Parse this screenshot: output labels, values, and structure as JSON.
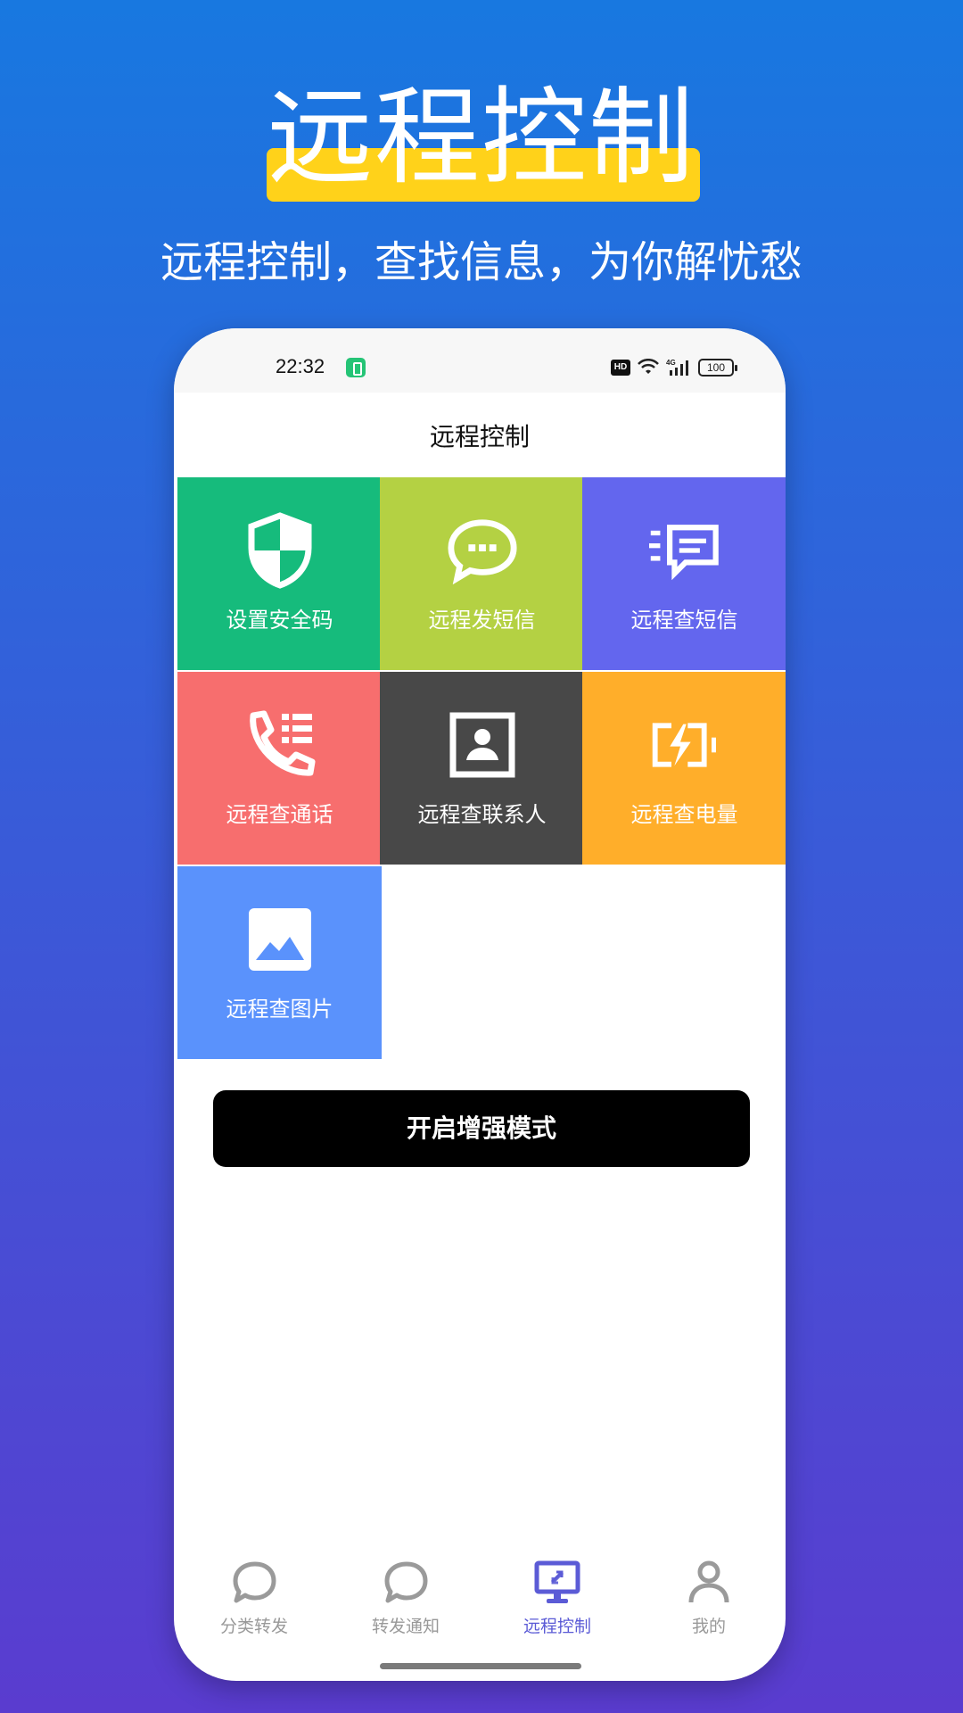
{
  "hero": {
    "title": "远程控制",
    "subtitle": "远程控制，查找信息，为你解忧愁",
    "highlight_color": "#ffd21a"
  },
  "status_bar": {
    "time": "22:32",
    "hd": "HD",
    "network": "4G",
    "battery": "100"
  },
  "header": {
    "title": "远程控制"
  },
  "tiles": [
    {
      "label": "设置安全码",
      "icon": "shield-icon",
      "color": "#16bb7c"
    },
    {
      "label": "远程发短信",
      "icon": "chat-bubble-icon",
      "color": "#b4d143"
    },
    {
      "label": "远程查短信",
      "icon": "message-list-icon",
      "color": "#6366ee"
    },
    {
      "label": "远程查通话",
      "icon": "phone-list-icon",
      "color": "#f76e6e"
    },
    {
      "label": "远程查联系人",
      "icon": "contact-card-icon",
      "color": "#484848"
    },
    {
      "label": "远程查电量",
      "icon": "battery-charging-icon",
      "color": "#ffae2a"
    },
    {
      "label": "远程查图片",
      "icon": "image-icon",
      "color": "#5a92fc"
    }
  ],
  "enhance_button": {
    "label": "开启增强模式"
  },
  "tabbar": {
    "active_color": "#5b5bd6",
    "items": [
      {
        "label": "分类转发",
        "icon": "chat-bubble-icon",
        "active": false
      },
      {
        "label": "转发通知",
        "icon": "chat-bubble-icon",
        "active": false
      },
      {
        "label": "远程控制",
        "icon": "remote-desktop-icon",
        "active": true
      },
      {
        "label": "我的",
        "icon": "user-icon",
        "active": false
      }
    ]
  }
}
